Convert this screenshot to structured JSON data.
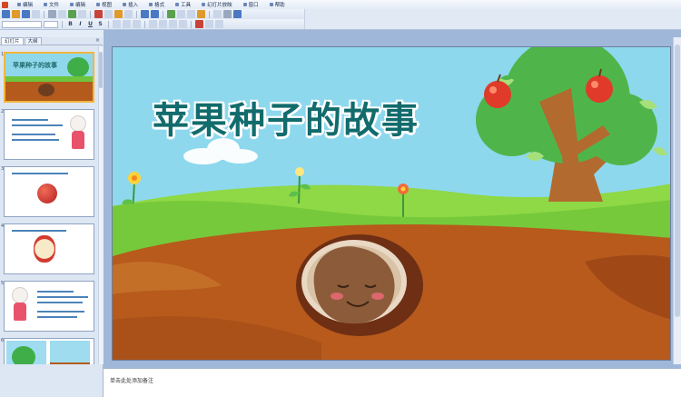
{
  "menu": {
    "items": [
      {
        "label": "编辑"
      },
      {
        "label": "文件"
      },
      {
        "label": "编辑"
      },
      {
        "label": "视图"
      },
      {
        "label": "插入"
      },
      {
        "label": "格式"
      },
      {
        "label": "工具"
      },
      {
        "label": "幻灯片放映"
      },
      {
        "label": "窗口"
      },
      {
        "label": "帮助"
      }
    ]
  },
  "toolbar2": {
    "bold_label": "B",
    "italic_label": "I",
    "underline_label": "U",
    "shadow_label": "S"
  },
  "left_panel": {
    "tabs": [
      {
        "label": "幻灯片"
      },
      {
        "label": "大纲"
      }
    ],
    "close_label": "×",
    "slide_numbers": [
      "1",
      "2",
      "3",
      "4",
      "5",
      "6"
    ],
    "slide1_title": "苹果种子的故事"
  },
  "slide": {
    "title": "苹果种子的故事"
  },
  "notes": {
    "placeholder": "单击此处添加备注"
  },
  "colors": {
    "sky": "#8ed8ee",
    "grass": "#76c93a",
    "soil": "#b75a1c",
    "title_text": "#126b6c",
    "apple_red": "#e03a2a"
  }
}
